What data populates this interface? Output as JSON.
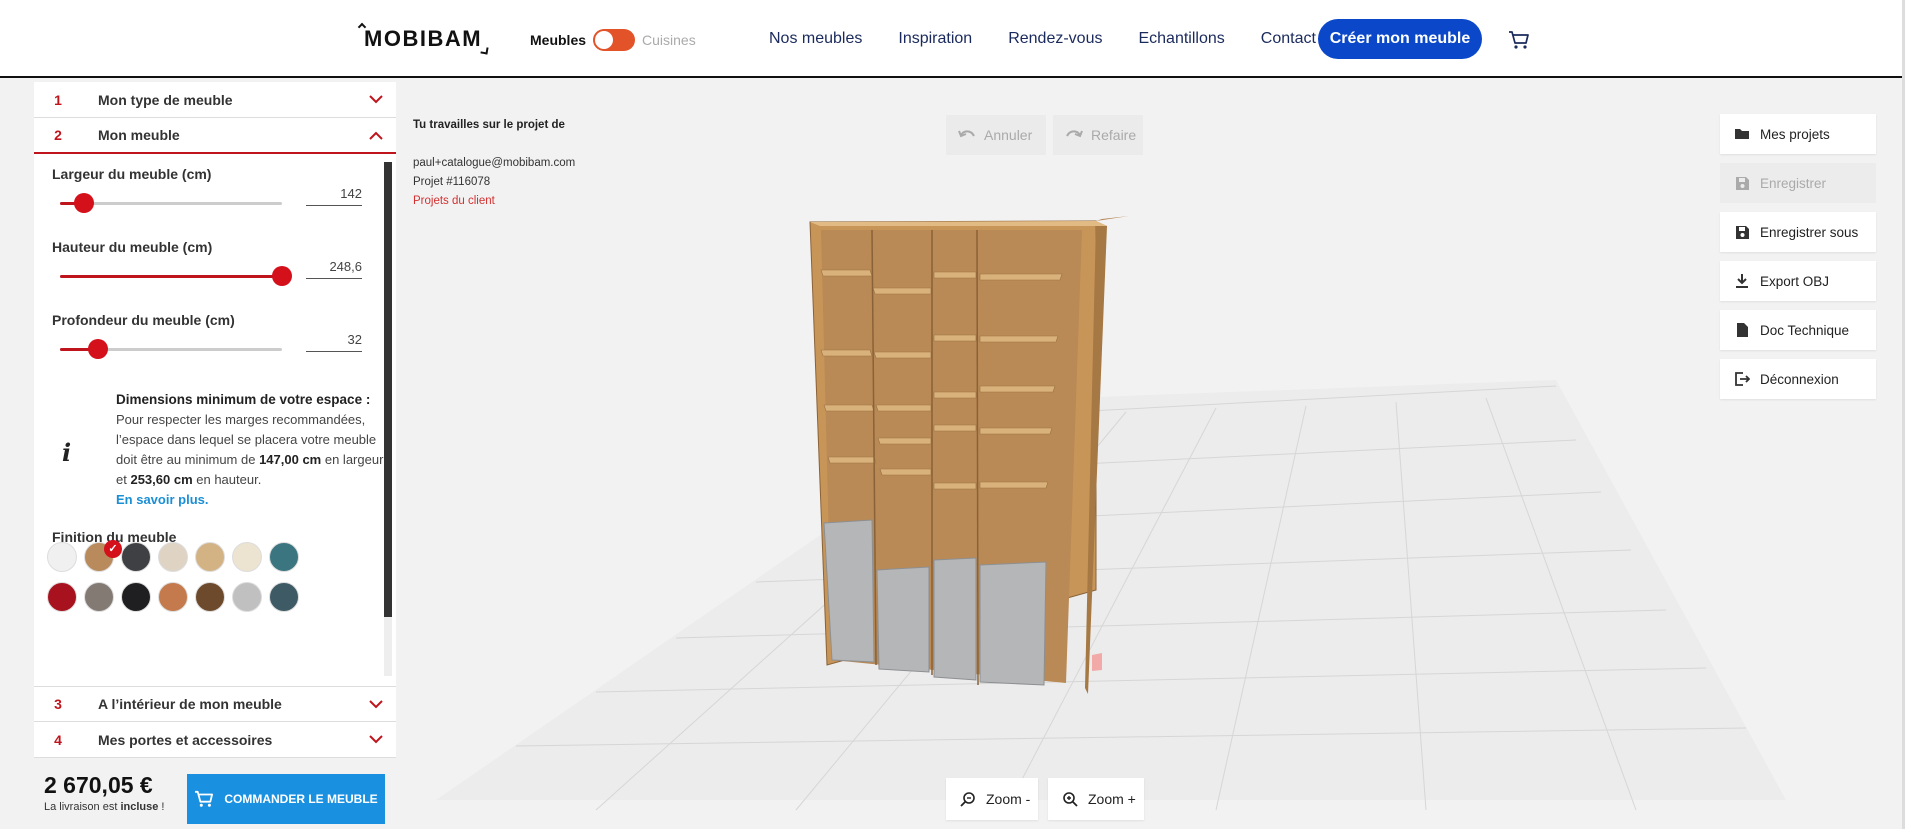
{
  "header": {
    "logo": "MOBIBAM",
    "toggle_on_label": "Meubles",
    "toggle_off_label": "Cuisines",
    "nav": [
      "Nos meubles",
      "Inspiration",
      "Rendez-vous",
      "Echantillons",
      "Contact"
    ],
    "cta": "Créer mon meuble"
  },
  "panel": {
    "sections": [
      {
        "num": "1",
        "title": "Mon type de meuble"
      },
      {
        "num": "2",
        "title": "Mon meuble"
      },
      {
        "num": "3",
        "title": "A l’intérieur de mon meuble"
      },
      {
        "num": "4",
        "title": "Mes portes et accessoires"
      }
    ],
    "sliders": [
      {
        "label": "Largeur du meuble (cm)",
        "value": "142",
        "level": 0.11
      },
      {
        "label": "Hauteur du meuble (cm)",
        "value": "248,6",
        "level": 1.0
      },
      {
        "label": "Profondeur du meuble (cm)",
        "value": "32",
        "level": 0.17
      }
    ],
    "info": {
      "title": "Dimensions minimum de votre espace :",
      "line1": "Pour respecter les marges recommandées, l’espace dans lequel se placera votre meuble doit être au minimum de ",
      "width_min": "147,00 cm",
      "mid": " en largeur et ",
      "height_min": "253,60 cm",
      "end": " en hauteur.",
      "link": "En savoir plus."
    },
    "finish_label": "Finition du meuble",
    "swatches": [
      "#f0f0f0",
      "#b88a5c",
      "#3f4044",
      "#dfd3c4",
      "#d3b384",
      "#ece3d0",
      "#3a7580",
      "#a8121f",
      "#837a73",
      "#1f1f21",
      "#c47a4c",
      "#6e4a2c",
      "#c0c0c0",
      "#3e5a65"
    ],
    "selected_swatch": 1
  },
  "footer": {
    "price": "2 670,05 €",
    "delivery_pre": "La livraison est ",
    "delivery_bold": "incluse",
    "delivery_post": " !",
    "order_label": "COMMANDER LE MEUBLE"
  },
  "project": {
    "heading": "Tu travailles sur le projet de",
    "email": "paul+catalogue@mobibam.com",
    "project_id": "Projet #116078",
    "client_link": "Projets du client"
  },
  "history": {
    "undo": "Annuler",
    "redo": "Refaire"
  },
  "tools": [
    {
      "label": "Mes projets",
      "icon": "folder-icon",
      "disabled": false
    },
    {
      "label": "Enregistrer",
      "icon": "save-icon",
      "disabled": true
    },
    {
      "label": "Enregistrer sous",
      "icon": "save-as-icon",
      "disabled": false
    },
    {
      "label": "Export OBJ",
      "icon": "download-icon",
      "disabled": false
    },
    {
      "label": "Doc Technique",
      "icon": "document-icon",
      "disabled": false
    },
    {
      "label": "Déconnexion",
      "icon": "logout-icon",
      "disabled": false
    }
  ],
  "zoom": {
    "out": "Zoom -",
    "in": "Zoom +"
  },
  "colors": {
    "accent_red": "#c0141c",
    "cta_blue": "#0a47c9",
    "order_blue": "#1a90e0",
    "wood": "#c8975c",
    "door_grey": "#b5b6b8"
  }
}
